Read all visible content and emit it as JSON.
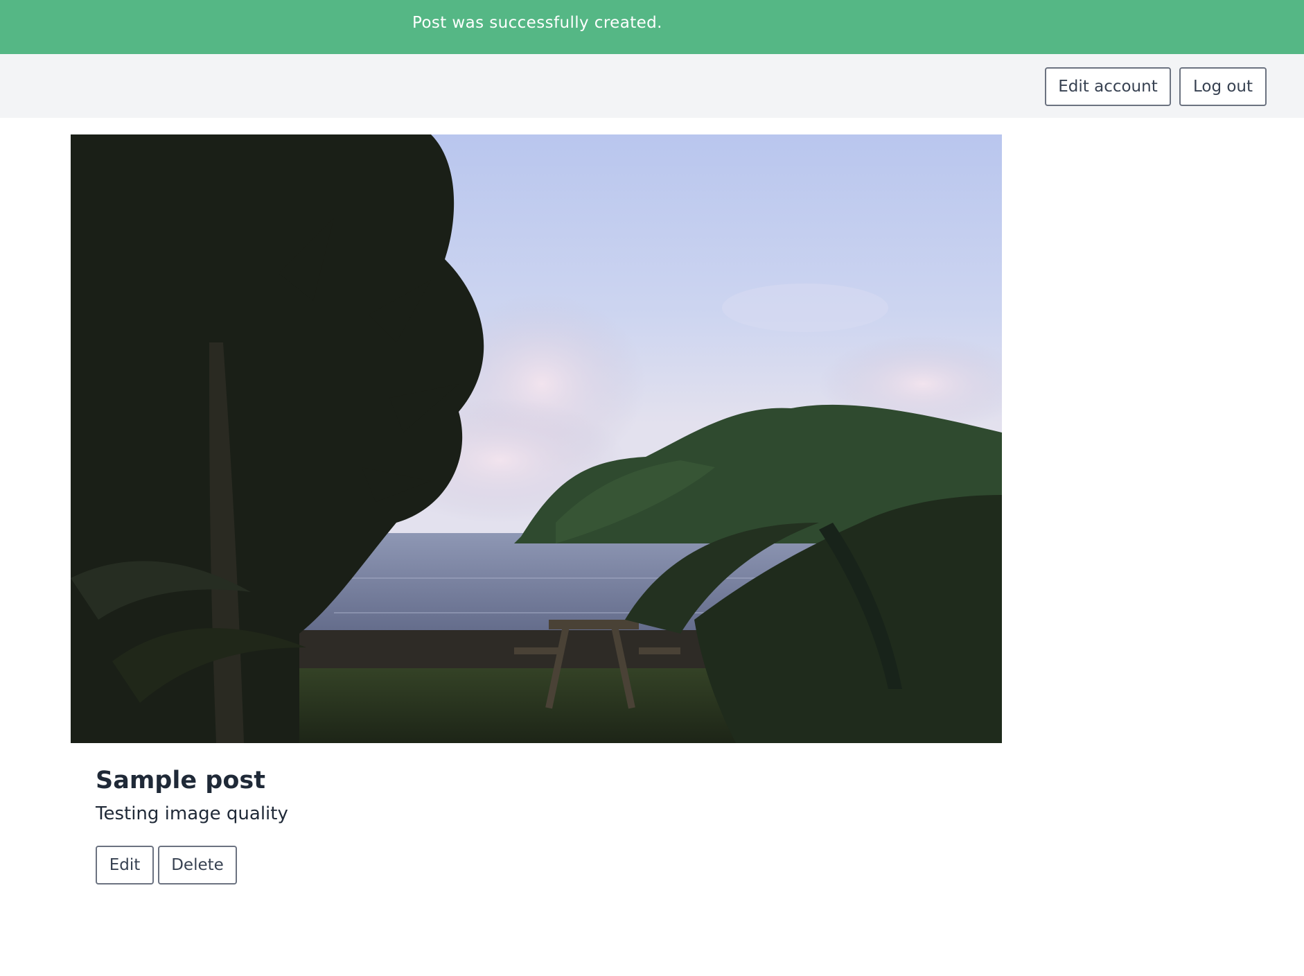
{
  "flash": {
    "message": "Post was successfully created."
  },
  "navbar": {
    "edit_account_label": "Edit account",
    "logout_label": "Log out"
  },
  "post": {
    "image_alt": "Photo of a tropical bay with palm trees, a picnic table, and a green hill under a cloudy sky",
    "title": "Sample post",
    "body": "Testing image quality",
    "edit_label": "Edit",
    "delete_label": "Delete"
  },
  "colors": {
    "flash_bg": "#55b785",
    "navbar_bg": "#f3f4f6",
    "button_border": "#6b7280",
    "text": "#1f2937"
  }
}
